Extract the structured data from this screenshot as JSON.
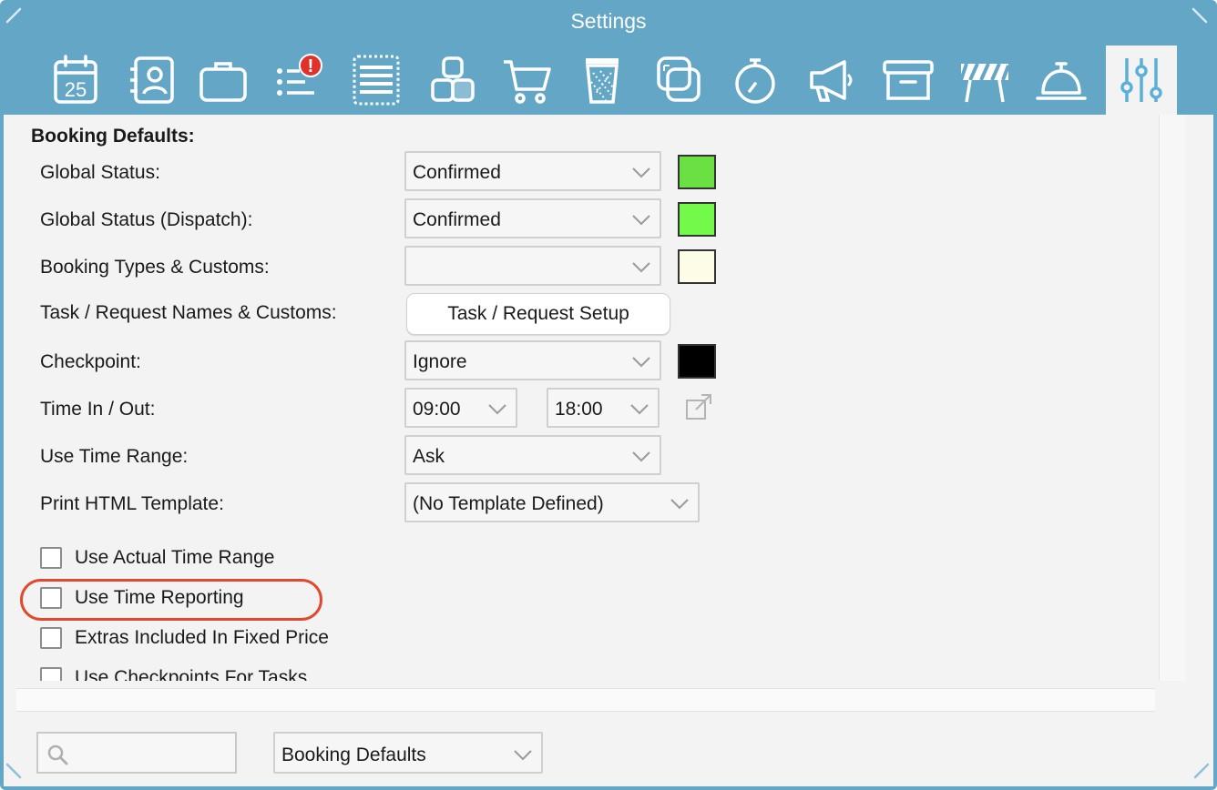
{
  "window": {
    "title": "Settings"
  },
  "toolbar": {
    "items": [
      {
        "icon": "calendar-icon",
        "badge": "25"
      },
      {
        "icon": "contacts-icon"
      },
      {
        "icon": "briefcase-icon"
      },
      {
        "icon": "task-list-alert-icon",
        "badge": "!"
      },
      {
        "icon": "list-document-icon"
      },
      {
        "icon": "resources-boxes-icon"
      },
      {
        "icon": "shopping-cart-icon"
      },
      {
        "icon": "trash-bin-icon"
      },
      {
        "icon": "layers-icon"
      },
      {
        "icon": "stopwatch-icon"
      },
      {
        "icon": "megaphone-icon"
      },
      {
        "icon": "archive-box-icon"
      },
      {
        "icon": "barrier-icon"
      },
      {
        "icon": "service-bell-icon"
      },
      {
        "icon": "sliders-settings-icon",
        "active": true
      }
    ]
  },
  "section": {
    "title": "Booking Defaults:"
  },
  "fields": {
    "global_status": {
      "label": "Global Status:",
      "value": "Confirmed",
      "color": "#6ae043"
    },
    "global_status_dispatch": {
      "label": "Global Status (Dispatch):",
      "value": "Confirmed",
      "color": "#72f94a"
    },
    "booking_types": {
      "label": "Booking Types & Customs:",
      "value": "",
      "color": "#fdfce6"
    },
    "task_request": {
      "label": "Task / Request Names & Customs:",
      "button": "Task / Request Setup"
    },
    "checkpoint": {
      "label": "Checkpoint:",
      "value": "Ignore",
      "color": "#000000"
    },
    "time_in_out": {
      "label": "Time In / Out:",
      "in": "09:00",
      "out": "18:00"
    },
    "use_time_range": {
      "label": "Use Time Range:",
      "value": "Ask"
    },
    "print_template": {
      "label": "Print HTML Template:",
      "value": "(No Template Defined)"
    }
  },
  "checkboxes": [
    {
      "label": "Use Actual Time Range",
      "checked": false
    },
    {
      "label": "Use Time Reporting",
      "checked": false,
      "highlighted": true
    },
    {
      "label": "Extras Included In Fixed Price",
      "checked": false
    },
    {
      "label": "Use Checkpoints For Tasks",
      "checked": false
    }
  ],
  "footer": {
    "search_value": "",
    "section_select": "Booking Defaults"
  },
  "colors": {
    "window_blue": "#63a6c6",
    "panel_bg": "#f3f3f3",
    "highlight_red": "#e0492e",
    "active_icon": "#5bb0da"
  }
}
